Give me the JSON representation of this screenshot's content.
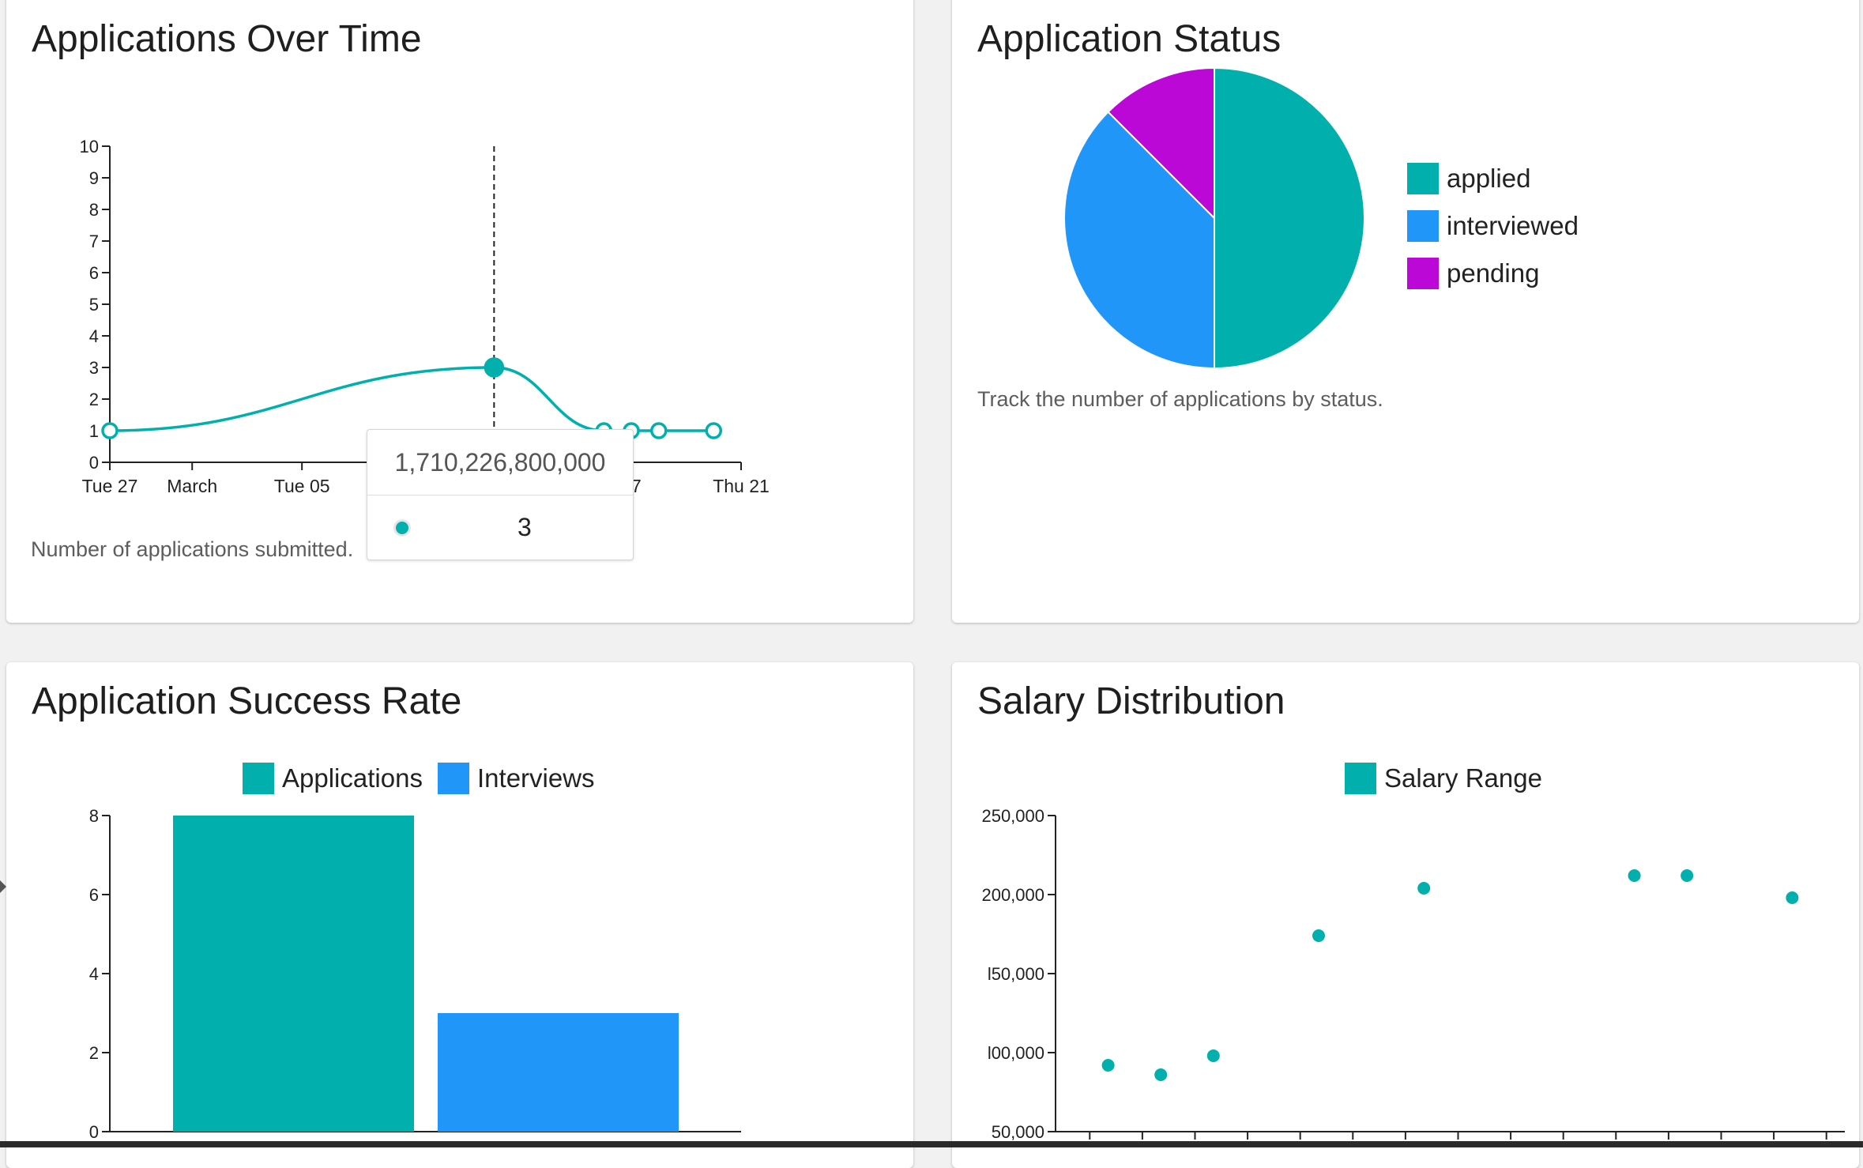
{
  "colors": {
    "teal": "#01b0ad",
    "blue": "#2196f9",
    "purple": "#bb08d6",
    "axis": "#222222"
  },
  "cards": {
    "over_time": {
      "title": "Applications Over Time",
      "caption": "Number of applications submitted.",
      "tooltip": {
        "label": "1,710,226,800,000",
        "value": "3"
      }
    },
    "status": {
      "title": "Application Status",
      "caption": "Track the number of applications by status.",
      "legend": [
        "applied",
        "interviewed",
        "pending"
      ]
    },
    "success": {
      "title": "Application Success Rate",
      "legend": [
        "Applications",
        "Interviews"
      ]
    },
    "salary": {
      "title": "Salary Distribution",
      "legend": [
        "Salary Range"
      ]
    }
  },
  "chart_data": [
    {
      "type": "line",
      "title": "Applications Over Time",
      "x": [
        "2024-02-27",
        "2024-03-12",
        "2024-03-16",
        "2024-03-17",
        "2024-03-18",
        "2024-03-20"
      ],
      "values": [
        1,
        3,
        1,
        1,
        1,
        1
      ],
      "highlighted_point": 1,
      "x_ticks": [
        "Tue 27",
        "March",
        "Tue 05",
        "",
        "",
        "17",
        "Thu 21"
      ],
      "x_tick_dates": [
        "2024-02-27",
        "2024-03-01",
        "2024-03-05",
        "2024-03-10",
        "2024-03-12",
        "2024-03-17",
        "2024-03-21"
      ],
      "xlim": [
        "2024-02-27",
        "2024-03-21"
      ],
      "ylim": [
        0,
        10
      ],
      "y_ticks": [
        "0",
        "1",
        "2",
        "3",
        "4",
        "5",
        "6",
        "7",
        "8",
        "9",
        "10"
      ]
    },
    {
      "type": "pie",
      "title": "Application Status",
      "labels": [
        "applied",
        "interviewed",
        "pending"
      ],
      "values": [
        4,
        3,
        1
      ],
      "legend_position": "right"
    },
    {
      "type": "bar",
      "title": "Application Success Rate",
      "series": [
        {
          "name": "Applications",
          "values": [
            8
          ]
        },
        {
          "name": "Interviews",
          "values": [
            3
          ]
        }
      ],
      "ylim": [
        0,
        8
      ],
      "y_ticks": [
        "0",
        "2",
        "4",
        "6",
        "8"
      ],
      "legend_position": "top"
    },
    {
      "type": "scatter",
      "title": "Salary Distribution",
      "series": [
        {
          "name": "Salary Range",
          "x": [
            1,
            2,
            3,
            5,
            7,
            11,
            12,
            14
          ],
          "y": [
            92000,
            86000,
            98000,
            174000,
            204000,
            212000,
            212000,
            198000
          ]
        }
      ],
      "xlim": [
        0,
        15
      ],
      "ylim": [
        50000,
        250000
      ],
      "y_ticks": [
        "50,000",
        "100,000",
        "150,000",
        "200,000",
        "250,000"
      ],
      "y_ticks_visible": [
        "50,000",
        "l00,000",
        "l50,000",
        "200,000",
        "250,000"
      ],
      "legend_position": "top"
    }
  ]
}
